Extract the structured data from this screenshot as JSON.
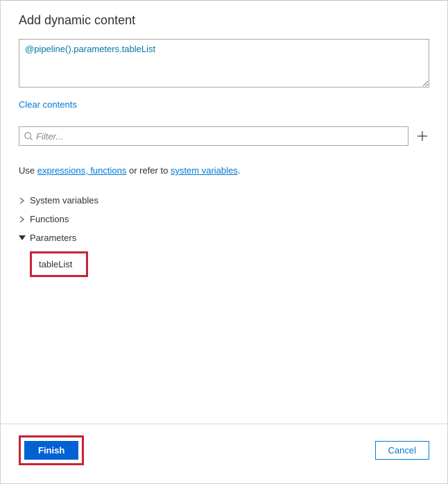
{
  "header": {
    "title": "Add dynamic content"
  },
  "expression": {
    "value": "@pipeline().parameters.tableList"
  },
  "actions": {
    "clear": "Clear contents"
  },
  "filter": {
    "placeholder": "Filter..."
  },
  "help": {
    "prefix": "Use ",
    "link1": "expressions, functions",
    "middle": " or refer to ",
    "link2": "system variables",
    "suffix": "."
  },
  "tree": {
    "sections": [
      {
        "label": "System variables",
        "expanded": false
      },
      {
        "label": "Functions",
        "expanded": false
      },
      {
        "label": "Parameters",
        "expanded": true
      }
    ],
    "parameter_items": [
      {
        "label": "tableList"
      }
    ]
  },
  "footer": {
    "finish": "Finish",
    "cancel": "Cancel"
  }
}
